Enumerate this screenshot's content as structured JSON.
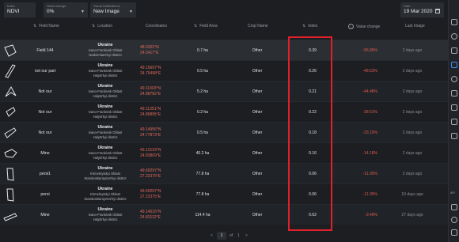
{
  "controls": {
    "index": {
      "label": "Index",
      "value": "NDVI"
    },
    "value_change": {
      "label": "Value change",
      "value": "0%"
    },
    "visual_notifications": {
      "label": "Visual Notifications",
      "value": "New Image"
    },
    "date": {
      "label": "Date",
      "value": "19 Mar 2020"
    }
  },
  "columns": {
    "field_name": "Field Name",
    "location": "Location",
    "coordinates": "Coordinates",
    "field_area": "Field Area",
    "crop_name": "Crop Name",
    "index": "Index",
    "value_change": "Value change",
    "last_image": "Last Image"
  },
  "rows": [
    {
      "name": "Field 144",
      "country": "Ukraine",
      "region": "Ivano-Frankivsk Oblast",
      "district": "Nadvirnians'kyi district",
      "lat": "48.6262°N",
      "lon": "24.5417°E",
      "area": "0.7 ha",
      "crop": "Other",
      "index": "0.39",
      "change": "-96.85%",
      "last": "2 days ago"
    },
    {
      "name": "not our part",
      "country": "Ukraine",
      "region": "Ivano-Frankivsk Oblast",
      "district": "Halyts'kyi district",
      "lat": "49.15697°N",
      "lon": "24.75498°E",
      "area": "0.5 ha",
      "crop": "Other",
      "index": "0.26",
      "change": "-48.53%",
      "last": "2 days ago"
    },
    {
      "name": "Not our",
      "country": "Ukraine",
      "region": "Ivano-Frankivsk Oblast",
      "district": "Halyts'kyi district",
      "lat": "49.11003°N",
      "lon": "24.88782°E",
      "area": "5.2 ha",
      "crop": "Other",
      "index": "0.21",
      "change": "-44.48%",
      "last": "2 days ago"
    },
    {
      "name": "Not our",
      "country": "Ukraine",
      "region": "Ivano-Frankivsk Oblast",
      "district": "Halyts'kyi district",
      "lat": "49.11351°N",
      "lon": "24.86895°E",
      "area": "0.2 ha",
      "crop": "Other",
      "index": "0.22",
      "change": "-38.51%",
      "last": "2 days ago"
    },
    {
      "name": "Not our",
      "country": "Ukraine",
      "region": "Ivano-Frankivsk Oblast",
      "district": "Halyts'kyi district",
      "lat": "49.14956°N",
      "lon": "24.77873°E",
      "area": "0.5 ha",
      "crop": "Other",
      "index": "0.18",
      "change": "-33.15%",
      "last": "2 days ago"
    },
    {
      "name": "Mine",
      "country": "Ukraine",
      "region": "Ivano-Frankivsk Oblast",
      "district": "Halyts'kyi district",
      "lat": "49.12133°N",
      "lon": "24.83809°E",
      "area": "40.2 ha",
      "crop": "Other",
      "index": "0.16",
      "change": "-14.18%",
      "last": "2 days ago"
    },
    {
      "name": "persi1",
      "country": "Ukraine",
      "region": "Khmelnytskyi Oblast",
      "district": "Starokostiantynivs'kyi district",
      "lat": "49.69297°N",
      "lon": "27.22375°E",
      "area": "77.8 ha",
      "crop": "Other",
      "index": "0.06",
      "change": "-11.05%",
      "last": "2 days ago"
    },
    {
      "name": "persi",
      "country": "Ukraine",
      "region": "Khmelnytskyi Oblast",
      "district": "Starokostiantynivs'kyi district",
      "lat": "49.69297°N",
      "lon": "27.22375°E",
      "area": "77.8 ha",
      "crop": "Other",
      "index": "0.06",
      "change": "-11.05%",
      "last": "10 days ago"
    },
    {
      "name": "Mine",
      "country": "Ukraine",
      "region": "Ivano-Frankivsk Oblast",
      "district": "Halyts'kyi district",
      "lat": "49.14516°N",
      "lon": "24.83112°E",
      "area": "114.4 ha",
      "crop": "Other",
      "index": "0.62",
      "change": "-3.49%",
      "last": "27 days ago"
    }
  ],
  "pagination": {
    "prev": "<",
    "current": "1",
    "of": "of",
    "total": "1",
    "next": ">"
  },
  "right_rail": {
    "api_label": "API"
  },
  "colors": {
    "accent": "#3b8ef0",
    "highlight_frame": "#e0202a",
    "negative": "#e05a50",
    "coordinates": "#e06a5a"
  }
}
